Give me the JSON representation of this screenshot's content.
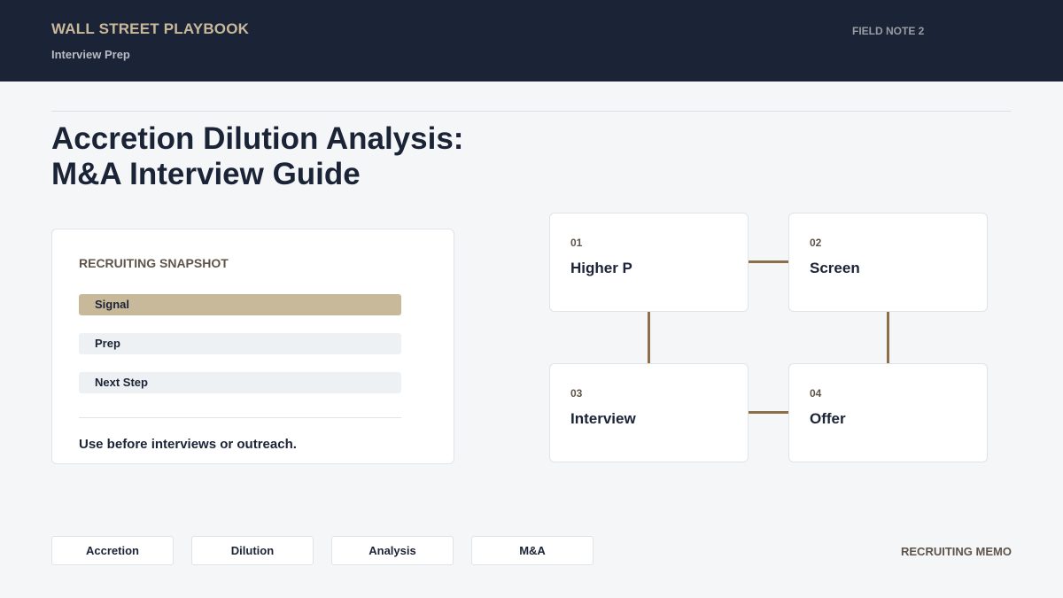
{
  "header": {
    "brand": "WALL STREET PLAYBOOK",
    "subtitle": "Interview Prep",
    "field_note": "FIELD NOTE 2"
  },
  "title": {
    "line1": "Accretion Dilution Analysis:",
    "line2": "M&A Interview Guide"
  },
  "snapshot": {
    "title": "RECRUITING SNAPSHOT",
    "items": [
      {
        "label": "Signal",
        "active": true
      },
      {
        "label": "Prep",
        "active": false
      },
      {
        "label": "Next Step",
        "active": false
      }
    ],
    "note": "Use before interviews or outreach."
  },
  "steps": [
    {
      "num": "01",
      "label": "Higher P"
    },
    {
      "num": "02",
      "label": "Screen"
    },
    {
      "num": "03",
      "label": "Interview"
    },
    {
      "num": "04",
      "label": "Offer"
    }
  ],
  "tags": [
    "Accretion",
    "Dilution",
    "Analysis",
    "M&A"
  ],
  "footer": {
    "memo": "RECRUITING MEMO"
  },
  "colors": {
    "navy": "#1b2336",
    "gold": "#c9b99b",
    "connector": "#8c6f48",
    "muted_brown": "#5f5449"
  }
}
